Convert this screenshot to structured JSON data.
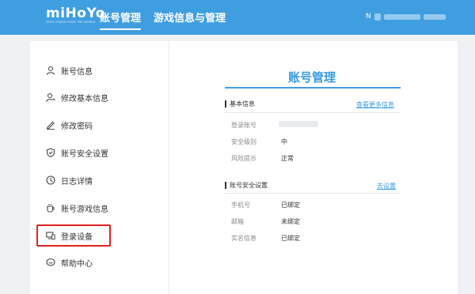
{
  "header": {
    "logo_text": "miHoYo",
    "logo_tagline": "TECH OTAKUS SAVE THE WORLD",
    "nav": [
      {
        "label": "账号管理",
        "active": true
      },
      {
        "label": "游戏信息与管理",
        "active": false
      }
    ],
    "user_prefix": "N"
  },
  "sidebar": {
    "items": [
      {
        "label": "账号信息",
        "icon": "user-icon"
      },
      {
        "label": "修改基本信息",
        "icon": "user-edit-icon"
      },
      {
        "label": "修改密码",
        "icon": "pencil-icon"
      },
      {
        "label": "账号安全设置",
        "icon": "shield-icon"
      },
      {
        "label": "日志详情",
        "icon": "clock-icon"
      },
      {
        "label": "账号游戏信息",
        "icon": "cup-icon"
      },
      {
        "label": "登录设备",
        "icon": "devices-icon",
        "highlighted": true
      },
      {
        "label": "帮助中心",
        "icon": "chat-icon"
      }
    ]
  },
  "main": {
    "title": "账号管理",
    "basic": {
      "heading": "基本信息",
      "link": "查看更多信息",
      "rows": [
        {
          "label": "登录账号",
          "value": ""
        },
        {
          "label": "安全级别",
          "value": "中"
        },
        {
          "label": "风险提示",
          "value": "正常"
        }
      ]
    },
    "security": {
      "heading": "账号安全设置",
      "link": "去设置",
      "rows": [
        {
          "label": "手机号",
          "value": "已绑定"
        },
        {
          "label": "邮箱",
          "value": "未绑定"
        },
        {
          "label": "实名信息",
          "value": "已绑定"
        }
      ]
    }
  },
  "colors": {
    "brand": "#3f9ee0",
    "highlight_border": "#e02020"
  }
}
